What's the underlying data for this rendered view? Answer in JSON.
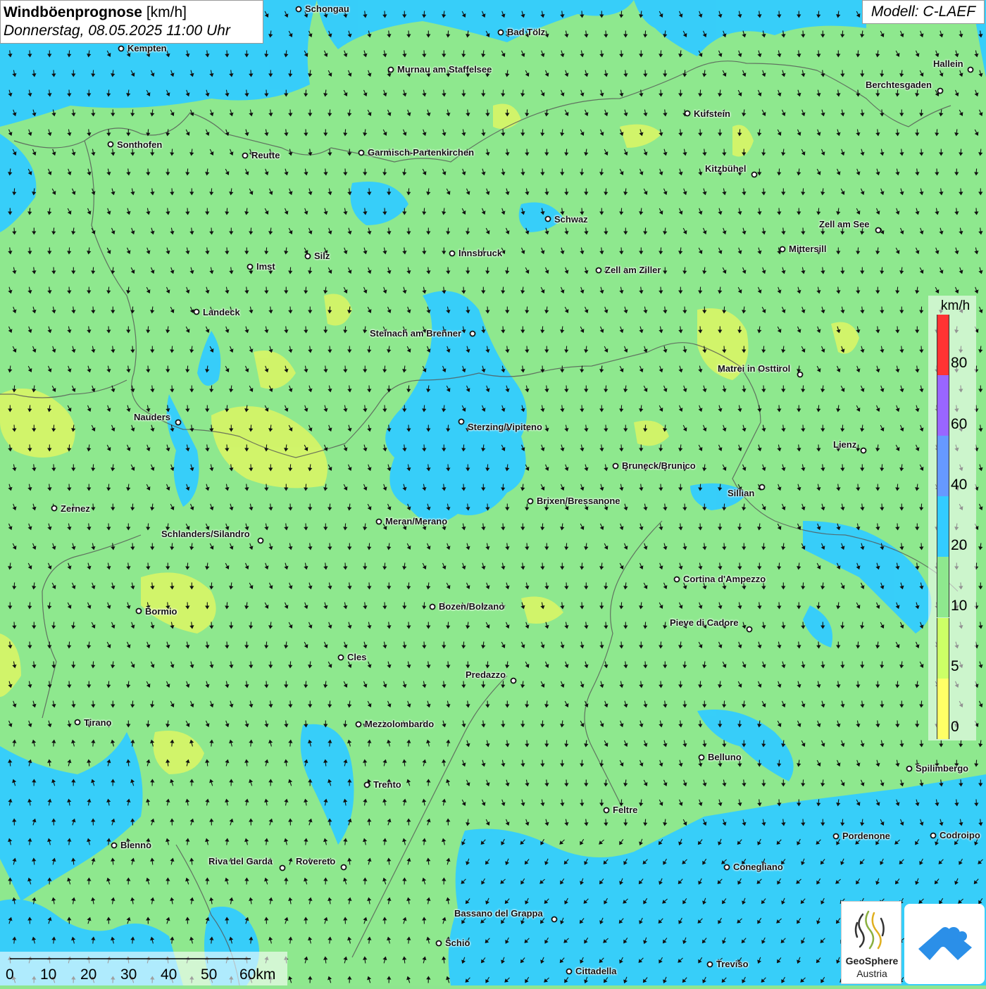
{
  "title": {
    "main": "Windböenprognose",
    "unit": "[km/h]",
    "datetime": "Donnerstag, 08.05.2025 11:00 Uhr"
  },
  "model": "Modell: C-LAEF",
  "legend": {
    "unit": "km/h",
    "stops": [
      {
        "label": "0",
        "color": "#ffff66"
      },
      {
        "label": "5",
        "color": "#ccff66"
      },
      {
        "label": "10",
        "color": "#8ee88e"
      },
      {
        "label": "20",
        "color": "#33ccff"
      },
      {
        "label": "40",
        "color": "#6699ff"
      },
      {
        "label": "60",
        "color": "#9966ff"
      },
      {
        "label": "80",
        "color": "#ff3333"
      }
    ]
  },
  "scalebar": {
    "labels": [
      "0",
      "10",
      "20",
      "30",
      "40",
      "50",
      "60km"
    ]
  },
  "logos": {
    "geosphere_name": "GeoSphere",
    "geosphere_sub": "Austria",
    "geosphere_icon": "geosphere-logo-icon",
    "app_icon": "app-logo-icon"
  },
  "colors": {
    "calm": "#ffff66",
    "light": "#ccff66",
    "base": "#8ee88e",
    "moderate": "#33ccff",
    "border": "#555555"
  },
  "cities": [
    {
      "name": "Schongau"
    },
    {
      "name": "Bad Tölz"
    },
    {
      "name": "Kempten"
    },
    {
      "name": "Murnau am Staffelsee"
    },
    {
      "name": "Hallein"
    },
    {
      "name": "Berchtesgaden"
    },
    {
      "name": "Kufstein"
    },
    {
      "name": "Sonthofen"
    },
    {
      "name": "Reutte"
    },
    {
      "name": "Garmisch-Partenkirchen"
    },
    {
      "name": "Kitzbühel"
    },
    {
      "name": "Schwaz"
    },
    {
      "name": "Zell am See"
    },
    {
      "name": "Mittersill"
    },
    {
      "name": "Silz"
    },
    {
      "name": "Innsbruck"
    },
    {
      "name": "Imst"
    },
    {
      "name": "Zell am Ziller"
    },
    {
      "name": "Landeck"
    },
    {
      "name": "Steinach am Brenner"
    },
    {
      "name": "Matrei in Osttirol"
    },
    {
      "name": "Nauders"
    },
    {
      "name": "Sterzing/Vipiteno"
    },
    {
      "name": "Lienz"
    },
    {
      "name": "Bruneck/Brunico"
    },
    {
      "name": "Sillian"
    },
    {
      "name": "Brixen/Bressanone"
    },
    {
      "name": "Zernez"
    },
    {
      "name": "Meran/Merano"
    },
    {
      "name": "Schlanders/Silandro"
    },
    {
      "name": "Cortina d'Ampezzo"
    },
    {
      "name": "Bormio"
    },
    {
      "name": "Bozen/Bolzano"
    },
    {
      "name": "Pieve di Cadore"
    },
    {
      "name": "Cles"
    },
    {
      "name": "Predazzo"
    },
    {
      "name": "Tirano"
    },
    {
      "name": "Mezzolombardo"
    },
    {
      "name": "Belluno"
    },
    {
      "name": "Spilimbergo"
    },
    {
      "name": "Trento"
    },
    {
      "name": "Feltre"
    },
    {
      "name": "Pordenone"
    },
    {
      "name": "Codroipo"
    },
    {
      "name": "Bienno"
    },
    {
      "name": "Riva del Garda"
    },
    {
      "name": "Rovereto"
    },
    {
      "name": "Conegliano"
    },
    {
      "name": "Bassano del Grappa"
    },
    {
      "name": "Schio"
    },
    {
      "name": "Treviso"
    },
    {
      "name": "Cittadella"
    }
  ]
}
